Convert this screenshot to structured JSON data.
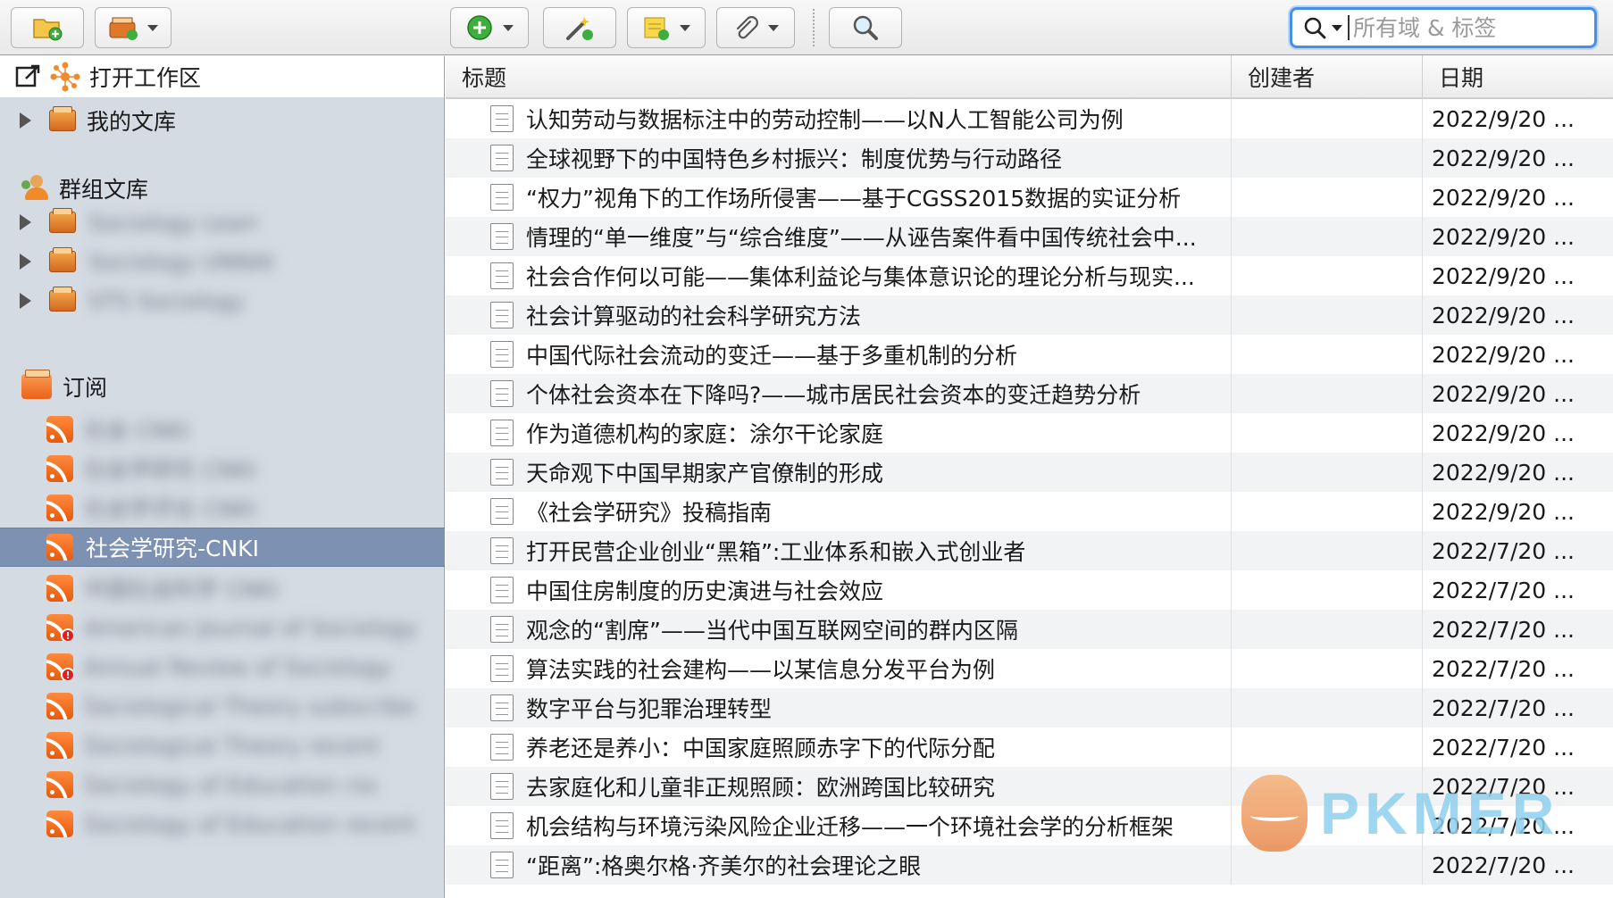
{
  "toolbar": {
    "search_placeholder": "所有域 & 标签"
  },
  "sidebar": {
    "open_workspace": "打开工作区",
    "my_library": "我的文库",
    "group_libraries": "群组文库",
    "groups": [
      {
        "label": "Sociology Learn"
      },
      {
        "label": "Sociology UNNAI"
      },
      {
        "label": "STS Sociology"
      }
    ],
    "feeds_header": "订阅",
    "feeds": [
      {
        "label": "社会 CNKI",
        "error": false
      },
      {
        "label": "社会学研究 CNKI",
        "error": false
      },
      {
        "label": "社会学评论 CNKI",
        "error": false
      },
      {
        "label": "社会学研究-CNKI",
        "error": false,
        "selected": true
      },
      {
        "label": "中国社会科学 CNKI",
        "error": false
      },
      {
        "label": "American Journal of Sociology",
        "error": true
      },
      {
        "label": "Annual Review of Sociology",
        "error": true
      },
      {
        "label": "Sociological Theory subscribe",
        "error": false
      },
      {
        "label": "Sociological Theory recent",
        "error": false
      },
      {
        "label": "Sociology of Education rss",
        "error": false
      },
      {
        "label": "Sociology of Education recent",
        "error": false
      }
    ]
  },
  "table": {
    "columns": [
      "标题",
      "创建者",
      "日期"
    ],
    "rows": [
      {
        "title": "认知劳动与数据标注中的劳动控制——以N人工智能公司为例",
        "creator": "",
        "date": "2022/9/20 ..."
      },
      {
        "title": "全球视野下的中国特色乡村振兴：制度优势与行动路径",
        "creator": "",
        "date": "2022/9/20 ..."
      },
      {
        "title": "“权力”视角下的工作场所侵害——基于CGSS2015数据的实证分析",
        "creator": "",
        "date": "2022/9/20 ..."
      },
      {
        "title": "情理的“单一维度”与“综合维度”——从诬告案件看中国传统社会中...",
        "creator": "",
        "date": "2022/9/20 ..."
      },
      {
        "title": "社会合作何以可能——集体利益论与集体意识论的理论分析与现实...",
        "creator": "",
        "date": "2022/9/20 ..."
      },
      {
        "title": "社会计算驱动的社会科学研究方法",
        "creator": "",
        "date": "2022/9/20 ..."
      },
      {
        "title": "中国代际社会流动的变迁——基于多重机制的分析",
        "creator": "",
        "date": "2022/9/20 ..."
      },
      {
        "title": "个体社会资本在下降吗?——城市居民社会资本的变迁趋势分析",
        "creator": "",
        "date": "2022/9/20 ..."
      },
      {
        "title": "作为道德机构的家庭：涂尔干论家庭",
        "creator": "",
        "date": "2022/9/20 ..."
      },
      {
        "title": "天命观下中国早期家产官僚制的形成",
        "creator": "",
        "date": "2022/9/20 ..."
      },
      {
        "title": "《社会学研究》投稿指南",
        "creator": "",
        "date": "2022/9/20 ..."
      },
      {
        "title": "打开民营企业创业“黑箱”:工业体系和嵌入式创业者",
        "creator": "",
        "date": "2022/7/20 ..."
      },
      {
        "title": "中国住房制度的历史演进与社会效应",
        "creator": "",
        "date": "2022/7/20 ..."
      },
      {
        "title": "观念的“割席”——当代中国互联网空间的群内区隔",
        "creator": "",
        "date": "2022/7/20 ..."
      },
      {
        "title": "算法实践的社会建构——以某信息分发平台为例",
        "creator": "",
        "date": "2022/7/20 ..."
      },
      {
        "title": "数字平台与犯罪治理转型",
        "creator": "",
        "date": "2022/7/20 ..."
      },
      {
        "title": "养老还是养小：中国家庭照顾赤字下的代际分配",
        "creator": "",
        "date": "2022/7/20 ..."
      },
      {
        "title": "去家庭化和儿童非正规照顾：欧洲跨国比较研究",
        "creator": "",
        "date": "2022/7/20 ..."
      },
      {
        "title": "机会结构与环境污染风险企业迁移——一个环境社会学的分析框架",
        "creator": "",
        "date": "2022/7/20 ..."
      },
      {
        "title": "“距离”:格奥尔格·齐美尔的社会理论之眼",
        "creator": "",
        "date": "2022/7/20 ..."
      }
    ]
  },
  "watermark": {
    "text": "PKMER"
  },
  "colors": {
    "selection": "#7d91b3",
    "sidebar_bg": "#d4dbe3",
    "search_focus": "#4a90e2",
    "rss_orange": "#ff7a2a"
  }
}
